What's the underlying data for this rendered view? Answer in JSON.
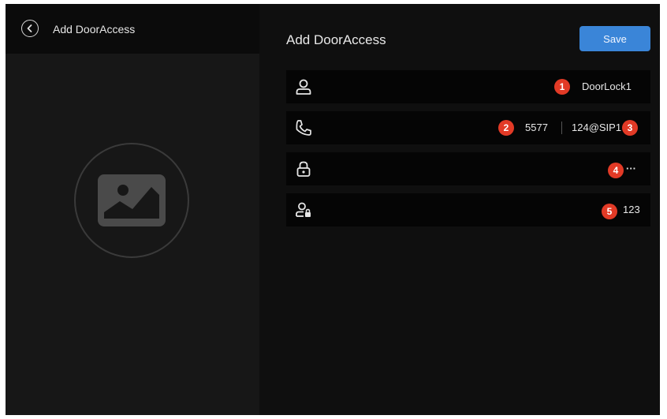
{
  "header": {
    "back_icon": "chevron-left-icon",
    "left_title": "Add DoorAccess"
  },
  "avatar": {
    "icon": "image-placeholder-icon"
  },
  "form": {
    "title": "Add DoorAccess",
    "save_label": "Save",
    "accent_color": "#3a85d8",
    "marker_color": "#e23a26",
    "fields": [
      {
        "icon": "user-icon",
        "value": "DoorLock1",
        "marker": "1"
      },
      {
        "icon": "phone-icon",
        "value": "5577",
        "value2": "124@SIP1",
        "marker": "2",
        "marker2": "3"
      },
      {
        "icon": "lock-icon",
        "value": "···",
        "marker": "4"
      },
      {
        "icon": "user-lock-icon",
        "value": "123",
        "marker": "5"
      }
    ]
  }
}
